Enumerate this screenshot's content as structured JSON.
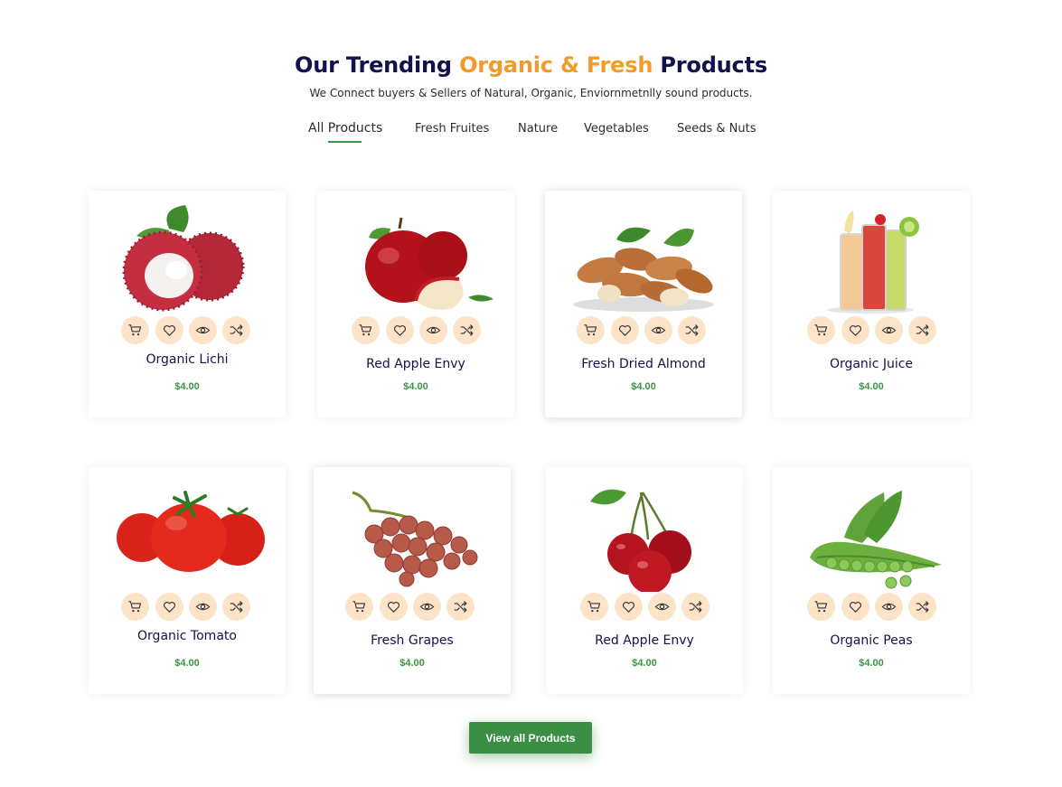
{
  "header": {
    "title_part1": "Our Trending ",
    "title_accent": "Organic & Fresh",
    "title_part2": " Products",
    "subtitle": "We Connect buyers & Sellers of Natural, Organic, Enviornmetnlly sound products."
  },
  "tabs": [
    {
      "label": "All Products",
      "active": true
    },
    {
      "label": "Fresh Fruites",
      "active": false
    },
    {
      "label": "Nature",
      "active": false
    },
    {
      "label": "Vegetables",
      "active": false
    },
    {
      "label": "Seeds & Nuts",
      "active": false
    }
  ],
  "products": [
    {
      "name": "Organic Lichi",
      "price": "$4.00",
      "image": "lychee-image"
    },
    {
      "name": "Red Apple Envy",
      "price": "$4.00",
      "image": "apple-image"
    },
    {
      "name": "Fresh Dried Almond",
      "price": "$4.00",
      "image": "almond-image"
    },
    {
      "name": "Organic Juice",
      "price": "$4.00",
      "image": "juice-image"
    },
    {
      "name": "Organic  Tomato",
      "price": "$4.00",
      "image": "tomato-image"
    },
    {
      "name": "Fresh Grapes",
      "price": "$4.00",
      "image": "grapes-image"
    },
    {
      "name": "Red Apple Envy",
      "price": "$4.00",
      "image": "cherry-image"
    },
    {
      "name": "Organic Peas",
      "price": "$4.00",
      "image": "peas-image"
    }
  ],
  "card_actions": [
    "cart-icon",
    "heart-icon",
    "eye-icon",
    "shuffle-icon"
  ],
  "view_all_label": "View all Products",
  "colors": {
    "title": "#13124a",
    "accent": "#f39b28",
    "green": "#3b9443",
    "action_bg": "#fde4c9"
  }
}
